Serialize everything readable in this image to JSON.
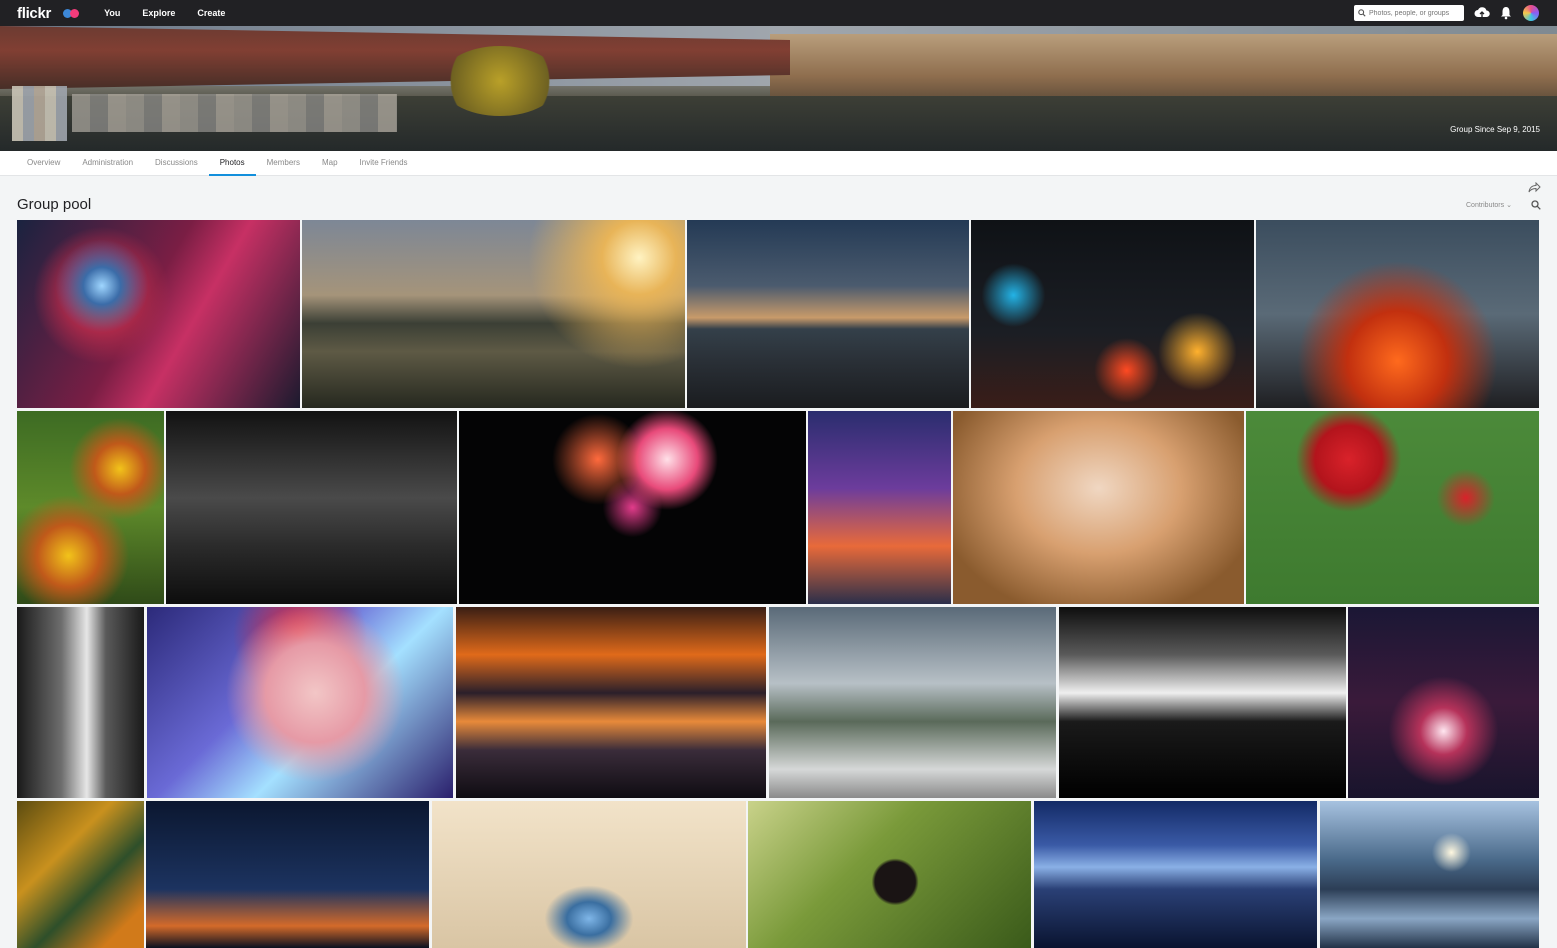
{
  "topbar": {
    "logo": "flickr",
    "nav": [
      "You",
      "Explore",
      "Create"
    ],
    "search_placeholder": "Photos, people, or groups"
  },
  "banner": {
    "since": "Group Since Sep 9, 2015"
  },
  "subnav": {
    "tabs": [
      "Overview",
      "Administration",
      "Discussions",
      "Photos",
      "Members",
      "Map",
      "Invite Friends"
    ],
    "active": "Photos"
  },
  "pool": {
    "title": "Group pool",
    "contributors_label": "Contributors"
  },
  "photos": [
    {
      "bg": "radial-gradient(circle at 30% 35%, #9fd6ff 0%, #3b6ca8 8%, transparent 20%), radial-gradient(circle at 30% 40%, #e8563a 0%, #b02a4a 15%, transparent 30%), linear-gradient(120deg,#1a2340 0%,#7a1e44 45%,#c73064 60%,#1b1a2e 100%)"
    },
    {
      "bg": "radial-gradient(circle at 88% 20%, #fff3c2 0%, #e8b458 10%, transparent 30%), linear-gradient(180deg,#7d8796 0%,#a5947a 40%,#3b3f35 55%,#5e5a45 70%,#26281f 100%)"
    },
    {
      "bg": "linear-gradient(180deg,#243a55 0%,#4b5b6e 35%,#c89a6a 52%,#34404a 58%,#2a3037 75%,#1a1c1f 100%)"
    },
    {
      "bg": "radial-gradient(circle at 15% 40%, #23b3e6 0%, transparent 12%), radial-gradient(circle at 55% 80%, #ff4a22 0%, transparent 15%), radial-gradient(circle at 80% 70%, #ffb12e 0%, transparent 15%), linear-gradient(180deg,#0f1216 0%,#1b1e24 60%,#3a1d18 100%)"
    },
    {
      "bg": "radial-gradient(ellipse at 50% 75%, #ff6a1d 0%, #c2300f 25%, transparent 50%), linear-gradient(180deg,#3b4d5e 0%,#5a6a77 50%,#1f1f22 100%)"
    },
    {
      "bg": "radial-gradient(circle at 35% 75%, #f2c31a 0%, #c0591a 18%, transparent 35%), radial-gradient(circle at 70% 30%, #f2c31a 0%, #c0591a 15%, transparent 30%), linear-gradient(180deg,#3d6b23 0%,#5e8a2a 50%,#2f4a18 100%)"
    },
    {
      "bg": "linear-gradient(180deg,#121212 0%,#4a4a4a 45%,#2b2b2b 70%,#0d0d0d 100%)"
    },
    {
      "bg": "radial-gradient(circle at 40% 25%, #ff6a3d 0%, transparent 18%), radial-gradient(circle at 60% 25%, #ffe0e8 0%, #e84a7a 12%, transparent 20%), radial-gradient(circle at 50% 50%, #e23c8b 0%, transparent 15%), #040405"
    },
    {
      "bg": "linear-gradient(180deg,#2a2d6e 0%,#6c3c9c 40%,#e86a3a 70%,#2b2f4a 100%)"
    },
    {
      "bg": "radial-gradient(ellipse at 50% 40%, #f0d7c2 0%, #d8a070 40%, #8a5b2e 80%), #b98445"
    },
    {
      "bg": "radial-gradient(circle at 35% 25%, #d9222a 0%, #b3141c 14%, transparent 22%), radial-gradient(circle at 75% 45%, #d9222a 0%, transparent 12%), linear-gradient(180deg,#4c8a3a 0%,#3e7a2f 100%)"
    },
    {
      "bg": "linear-gradient(90deg,#1a1a1a 0%,#6d6d6d 35%,#e6e6e6 55%,#5a5a5a 70%,#1a1a1a 100%)"
    },
    {
      "bg": "radial-gradient(circle at 55% 45%, #f2c6c6 0%, #e69aa6 25%, transparent 45%), radial-gradient(circle at 50% 15%, #e8202a 0%, transparent 30%), linear-gradient(135deg,#2c2a7a 0%,#6a6ad6 40%,#a4e0ff 60%,#2a1f6c 100%)"
    },
    {
      "bg": "linear-gradient(180deg,#3a1e14 0%,#e06a1a 25%,#2b1f2a 45%,#e88a3a 60%,#3a2c3a 75%,#0f0c12 100%)"
    },
    {
      "bg": "linear-gradient(180deg,#5a6a78 0%,#b7c0c6 40%,#5a6a5a 60%,#d6d8d8 85%,#8a8a8a 100%)"
    },
    {
      "bg": "linear-gradient(180deg,#0e0e0e 0%,#5a5a5a 25%,#efefef 45%,#1a1a1a 60%,#000 100%)"
    },
    {
      "bg": "radial-gradient(circle at 50% 65%, #ffe6f0 0%, #b5325a 15%, transparent 35%), linear-gradient(180deg,#1b1735 0%,#3a1a3a 50%,#18142c 100%)"
    },
    {
      "bg": "linear-gradient(135deg,#5c4c10 0%,#c9911e 35%,#2e4f2a 60%,#d17a1a 85%)"
    },
    {
      "bg": "linear-gradient(180deg,#0b1730 0%,#1c3360 60%,#d36a2a 85%,#0b1020 100%)"
    },
    {
      "bg": "radial-gradient(ellipse at 50% 80%, #7fb6e8 0%, #3a6ea0 10%, transparent 20%), linear-gradient(180deg,#f2e3c9 0%,#d9c5a4 100%)"
    },
    {
      "bg": "radial-gradient(circle at 52% 55%, #1a1414 0%, #1a1414 12%, transparent 14%), linear-gradient(135deg,#c9d28a 0%,#7a9a3a 40%,#3a5a1a 100%)"
    },
    {
      "bg": "linear-gradient(180deg,#132a66 0%,#3a5aa6 30%,#8ab0e6 45%,#2a4076 60%,#0a1430 100%)"
    },
    {
      "bg": "radial-gradient(circle at 60% 35%, #fff8e0 0%, transparent 12%), linear-gradient(180deg,#a7c2e0 0%,#4a6a8a 40%,#2c3e56 60%,#8aa6c4 80%,#223248 100%)"
    }
  ]
}
